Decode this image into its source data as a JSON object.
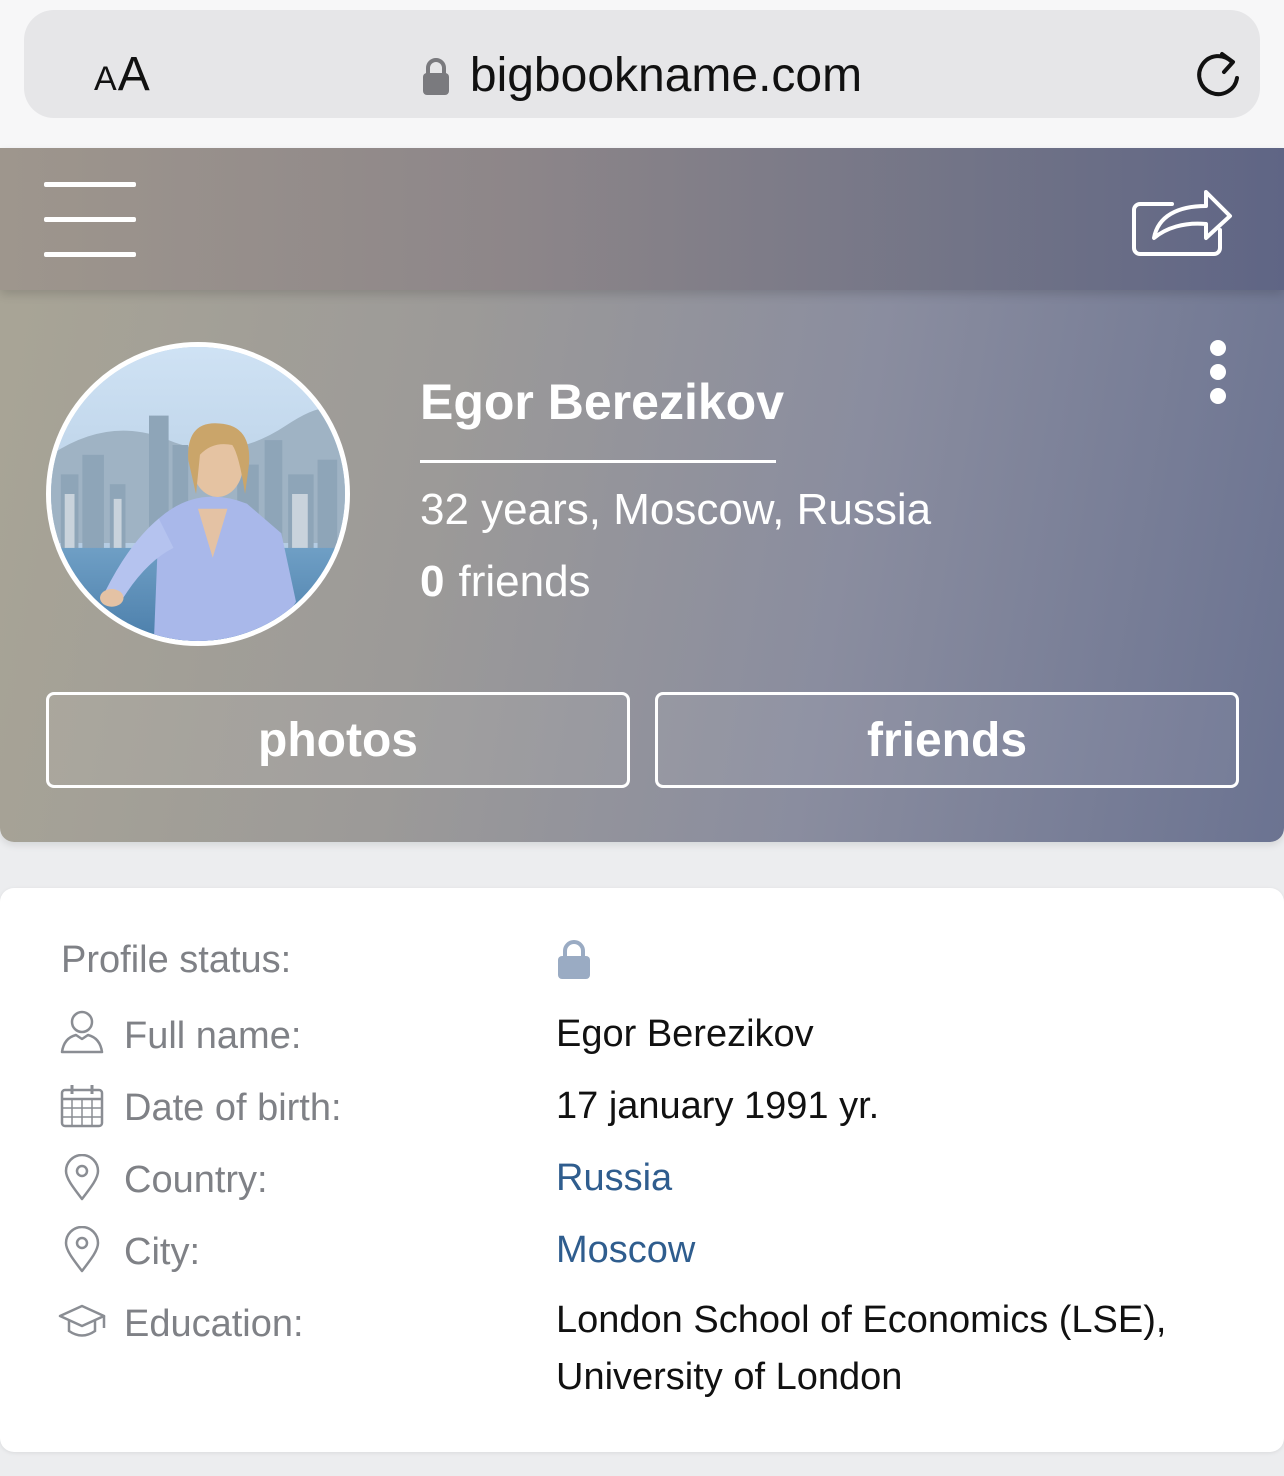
{
  "browser": {
    "aa_small": "A",
    "aa_big": "A",
    "url": "bigbookname.com"
  },
  "profile": {
    "name": "Egor Berezikov",
    "meta": "32 years, Moscow, Russia",
    "friends_count": "0",
    "friends_label": "friends",
    "photos_button": "photos",
    "friends_button": "friends"
  },
  "info": {
    "status_label": "Profile status:",
    "rows": [
      {
        "icon": "person-icon",
        "label": "Full name:",
        "value": "Egor Berezikov"
      },
      {
        "icon": "calendar-icon",
        "label": "Date of birth:",
        "value": "17 january 1991 yr."
      },
      {
        "icon": "location-pin-icon",
        "label": "Country:",
        "value": "Russia"
      },
      {
        "icon": "location-pin-icon",
        "label": "City:",
        "value": "Moscow"
      },
      {
        "icon": "graduation-cap-icon",
        "label": "Education:",
        "value_line1": "London School of Economics (LSE),",
        "value_line2": "University of London"
      }
    ]
  },
  "colors": {
    "link": "#2f5d8e",
    "label": "#7f8186",
    "lock_status": "#9aabc3"
  }
}
